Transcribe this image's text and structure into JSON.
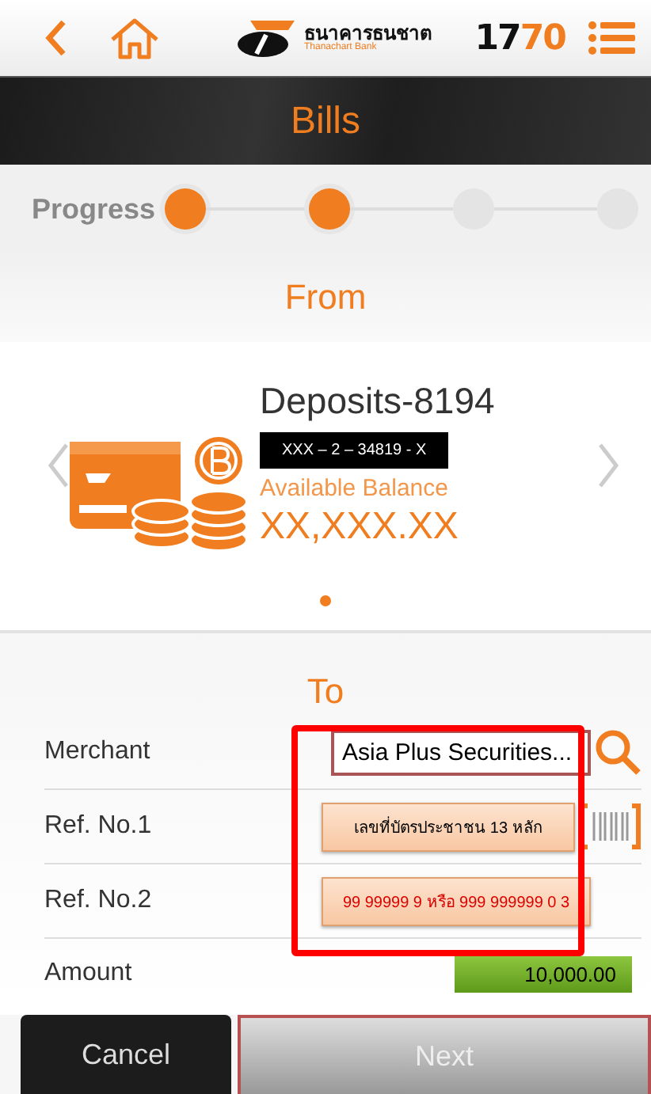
{
  "header": {
    "bank_name_thai": "ธนาคารธนชาต",
    "bank_name_english": "Thanachart Bank",
    "hotline": "1770"
  },
  "title": "Bills",
  "progress": {
    "label": "Progress",
    "steps": [
      {
        "done": true
      },
      {
        "done": true
      },
      {
        "done": false
      },
      {
        "done": false
      }
    ]
  },
  "from": {
    "heading": "From",
    "account_name": "Deposits-8194",
    "account_number": "XXX – 2 – 34819 - X",
    "balance_label": "Available Balance",
    "balance": "XX,XXX.XX",
    "pages": [
      {
        "selected": true
      }
    ]
  },
  "to": {
    "heading": "To",
    "rows": [
      {
        "kind": "text",
        "label": "Merchant",
        "value": "Asia Plus Securities..."
      },
      {
        "kind": "hint",
        "label": "Ref. No.1",
        "value": "เลขที่บัตรประชาชน 13 หลัก"
      },
      {
        "kind": "hint-red",
        "label": "Ref. No.2",
        "value": "99 99999 9 หรือ 999 999999 0 3"
      },
      {
        "kind": "amount",
        "label": "Amount",
        "value": "10,000.00"
      }
    ]
  },
  "buttons": {
    "cancel": "Cancel",
    "next": "Next"
  }
}
